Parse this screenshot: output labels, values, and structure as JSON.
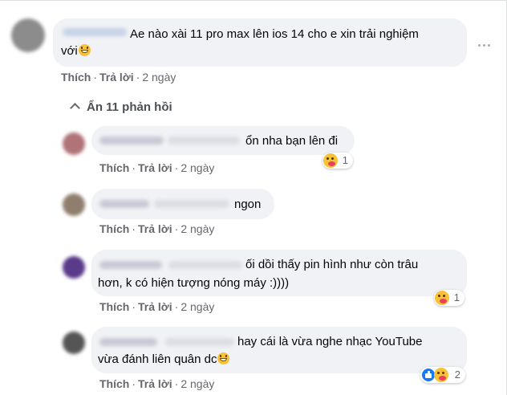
{
  "comment": {
    "text_line1": "Ae nào xài 11 pro max lên ios 14 cho e xin trải nghiệm",
    "text_line2": "với",
    "actions": {
      "like": "Thích",
      "reply": "Trả lời",
      "time": "2 ngày",
      "separator": "·"
    }
  },
  "toggle_replies": {
    "label": "Ẩn 11 phản hồi",
    "icon": "chevron-up-icon"
  },
  "replies": [
    {
      "text": "ổn nha bạn lên đi",
      "reaction_count": "1",
      "reactions": [
        "care"
      ],
      "like": "Thích",
      "reply": "Trả lời",
      "time": "2 ngày"
    },
    {
      "text": "ngon",
      "like": "Thích",
      "reply": "Trả lời",
      "time": "2 ngày"
    },
    {
      "text_line1": "ối dồi thấy pin hình như còn trâu",
      "text_line2": "hơn, k có hiện tượng nóng máy :))))",
      "reaction_count": "1",
      "reactions": [
        "care"
      ],
      "like": "Thích",
      "reply": "Trả lời",
      "time": "2 ngày"
    },
    {
      "text_line1": "hay cái là vừa nghe nhạc YouTube",
      "text_line2": "vừa đánh liên quân dc",
      "reaction_count": "2",
      "reactions": [
        "like",
        "care"
      ],
      "like": "Thích",
      "reply": "Trả lời",
      "time": "2 ngày"
    }
  ],
  "colors": {
    "bubble": "#f0f2f5",
    "action_text": "#65676b",
    "like_blue": "#1877f2",
    "emoji_yellow": "#f7c23a"
  }
}
